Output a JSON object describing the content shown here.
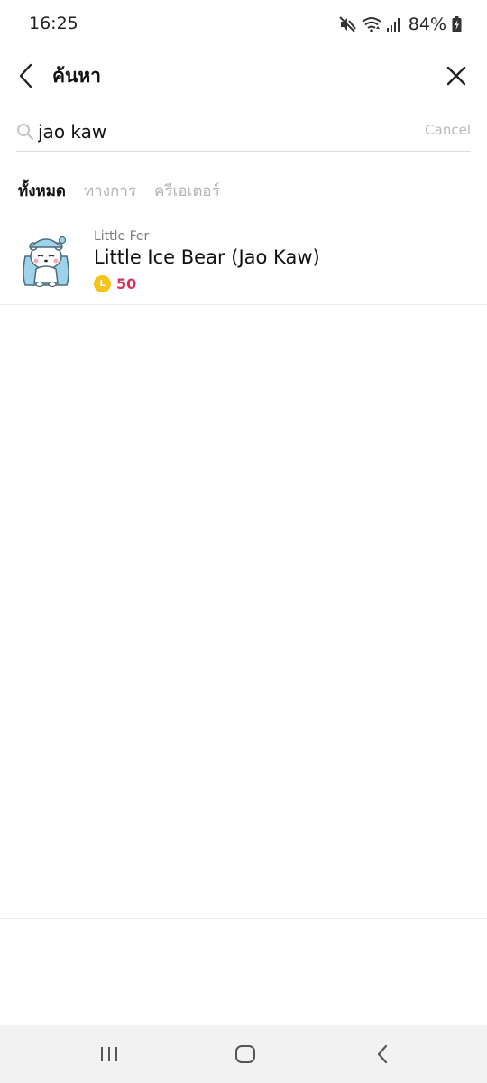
{
  "status_bar": {
    "time": "16:25",
    "battery": "84%",
    "icons": [
      "mute-icon",
      "wifi-icon",
      "signal-icon",
      "battery-charging-icon"
    ]
  },
  "header": {
    "title": "ค้นหา",
    "back_icon": "chevron-left-icon",
    "close_icon": "close-icon"
  },
  "search": {
    "value": "jao kaw",
    "placeholder": "",
    "cancel_label": "Cancel"
  },
  "tabs": [
    {
      "label": "ทั้งหมด",
      "active": true
    },
    {
      "label": "ทางการ",
      "active": false
    },
    {
      "label": "ครีเอเตอร์",
      "active": false
    }
  ],
  "results": [
    {
      "creator": "Little Fer",
      "title": "Little Ice Bear (Jao Kaw)",
      "coin_label": "L",
      "price": "50",
      "thumbnail": "ice-bear-sticker"
    }
  ],
  "nav_bar": {
    "icons": [
      "recent-apps-icon",
      "home-icon",
      "back-icon"
    ]
  },
  "colors": {
    "price": "#e0305a",
    "coin": "#f4c518",
    "tab_inactive": "#b3b3b3",
    "nav_bg": "#f2f2f2"
  }
}
